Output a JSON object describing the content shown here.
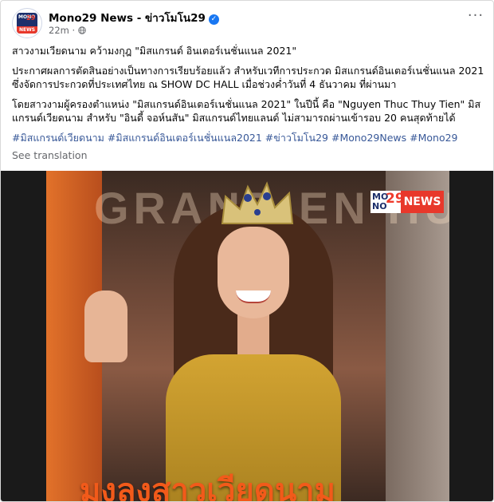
{
  "post": {
    "page_name": "Mono29 News - ข่าวโมโน29",
    "verified_glyph": "✓",
    "time": "22m",
    "separator": "·",
    "more_glyph": "···",
    "avatar": {
      "brand": "MONO",
      "number": "29",
      "label": "NEWS"
    },
    "paragraphs": [
      "สาวงามเวียดนาม คว้ามงกุฎ \"มิสแกรนด์ อินเตอร์เนชั่นแนล 2021\"",
      "ประกาศผลการตัดสินอย่างเป็นทางการเรียบร้อยแล้ว สำหรับเวทีการประกวด มิสแกรนด์อินเตอร์เนชั่นแนล 2021 ซึ่งจัดการประกวดที่ประเทศไทย ณ SHOW DC HALL เมื่อช่วงค่ำวันที่ 4 ธันวาคม ที่ผ่านมา",
      "โดยสาวงามผู้ครองตำแหน่ง \"มิสแกรนด์อินเตอร์เนชั่นแนล 2021\" ในปีนี้ คือ \"Nguyen Thuc Thuy Tien\" มิสแกรนด์เวียดนาม สำหรับ \"อินดี้ จอห์นสัน\" มิสแกรนด์ไทยแลนด์ ไม่สามารถผ่านเข้ารอบ 20 คนสุดท้ายได้"
    ],
    "hashtags": [
      "#มิสแกรนด์เวียดนาม",
      "#มิสแกรนด์อินเตอร์เนชั่นแนล2021",
      "#ข่าวโมโน29",
      "#Mono29News",
      "#Mono29"
    ],
    "see_translation": "See translation"
  },
  "photo": {
    "backdrop_text": "GRAND EN HU",
    "logo": {
      "mono": "MO NO",
      "number": "29",
      "news": "NEWS"
    },
    "headline": "มงลงสาวเวียดนาม"
  },
  "colors": {
    "link": "#385898",
    "verified": "#1877f2",
    "headline": "#f25a1a",
    "news_red": "#e8382b"
  }
}
